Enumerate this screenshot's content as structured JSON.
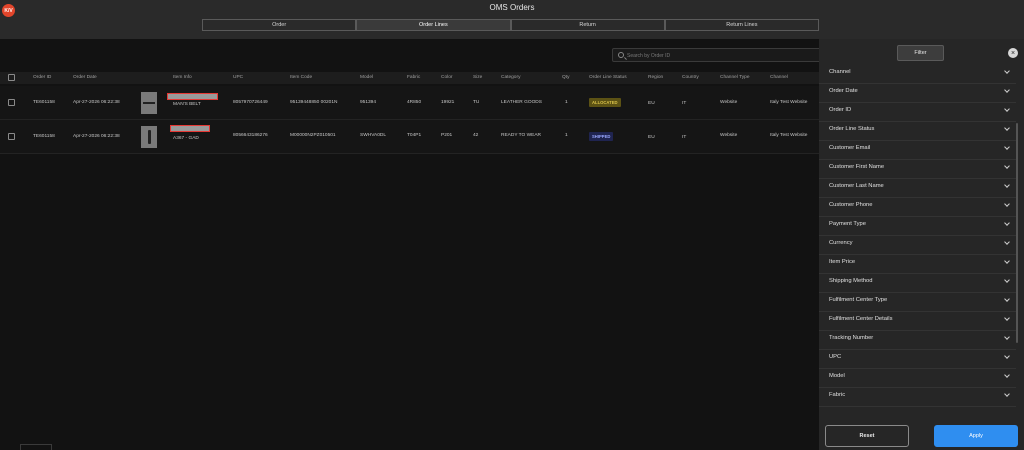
{
  "app": {
    "title": "OMS Orders",
    "logo_text": "K/V",
    "logo_color": "#e2452b"
  },
  "tabs": [
    {
      "label": "Order",
      "active": false
    },
    {
      "label": "Order Lines",
      "active": true
    },
    {
      "label": "Return",
      "active": false
    },
    {
      "label": "Return Lines",
      "active": false
    }
  ],
  "search": {
    "placeholder": "Search by Order ID",
    "value": ""
  },
  "table": {
    "columns": [
      "Order ID",
      "Order Date",
      "Item Info",
      "UPC",
      "Item Code",
      "Model",
      "Fabric",
      "Color",
      "Size",
      "Category",
      "Qty",
      "Order Line Status",
      "Region",
      "Country",
      "Channel Type",
      "Channel"
    ],
    "rows": [
      {
        "order_id": "TE601158",
        "order_date": "Apr-27-2026 06:22:38",
        "item_name": "MAN'S BELT",
        "upc": "8057970726449",
        "item_code": "95139448850 00201N",
        "model": "951394",
        "fabric": "4R850",
        "color": "19921",
        "size": "TU",
        "category": "LEATHER GOODS",
        "qty": "1",
        "status": "ALLOCATED",
        "region": "EU",
        "country": "IT",
        "channel_type": "Website",
        "channel": "Italy Test Website"
      },
      {
        "order_id": "TE601158",
        "order_date": "Apr-27-2026 06:22:38",
        "item_name": "A367 - GAD",
        "upc": "8056643186276",
        "item_code": "M00000N2PZ010501",
        "model": "SWHVA0DL",
        "fabric": "T04P1",
        "color": "P201",
        "size": "42",
        "category": "READY TO WEAR",
        "qty": "1",
        "status": "SHIPPED",
        "region": "EU",
        "country": "IT",
        "channel_type": "Website",
        "channel": "Italy Test Website"
      }
    ]
  },
  "filter_panel": {
    "title": "Filter",
    "close_label": "×",
    "items": [
      "Channel",
      "Order Date",
      "Order ID",
      "Order Line Status",
      "Customer Email",
      "Customer First Name",
      "Customer Last Name",
      "Customer Phone",
      "Payment Type",
      "Currency",
      "Item Price",
      "Shipping Method",
      "Fulfilment Center Type",
      "Fulfilment Center Details",
      "Tracking Number",
      "UPC",
      "Model",
      "Fabric"
    ],
    "reset_label": "Reset",
    "apply_label": "Apply",
    "apply_color": "#2f8ef0"
  },
  "icons": {
    "search": "search-icon",
    "close": "close-icon",
    "chevron": "chevron-down-icon"
  }
}
